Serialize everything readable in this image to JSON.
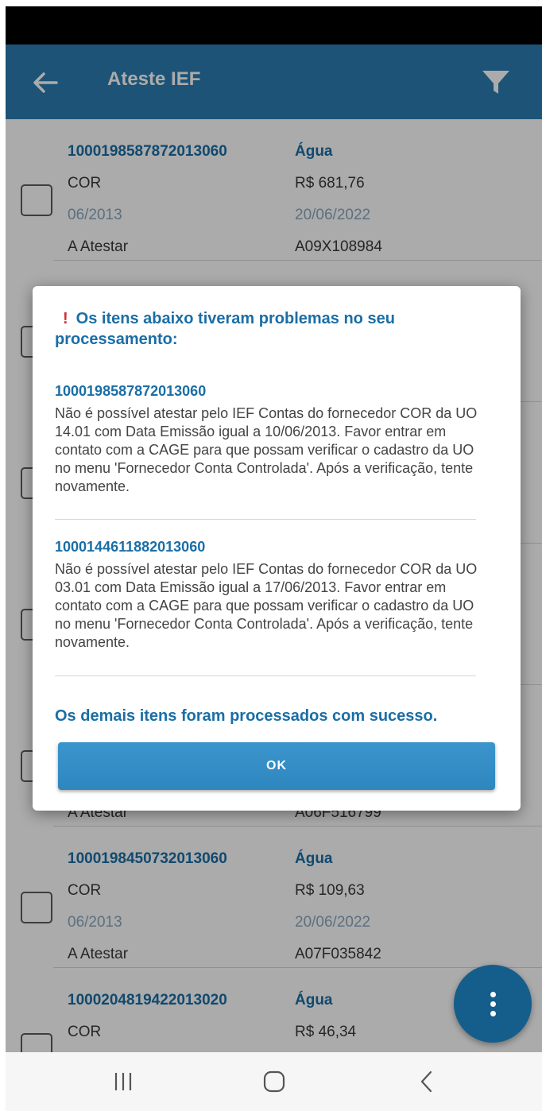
{
  "app_bar": {
    "title": "Ateste IEF",
    "back_icon": "back-arrow-icon",
    "filter_icon": "filter-icon",
    "color": "#2a7db0"
  },
  "list": {
    "items": [
      {
        "code": "1000198587872013060",
        "type": "Água",
        "supplier": "COR",
        "amount": "R$ 681,76",
        "reference": "06/2013",
        "date": "20/06/2022",
        "status": "A Atestar",
        "doc": "A09X108984"
      },
      {
        "code": "",
        "type": "",
        "supplier": "",
        "amount": "",
        "reference": "",
        "date": "",
        "status": "",
        "doc": ""
      },
      {
        "code": "",
        "type": "",
        "supplier": "",
        "amount": "",
        "reference": "",
        "date": "",
        "status": "",
        "doc": ""
      },
      {
        "code": "",
        "type": "",
        "supplier": "",
        "amount": "",
        "reference": "",
        "date": "",
        "status": "",
        "doc": ""
      },
      {
        "code": "",
        "type": "",
        "supplier": "",
        "amount": "",
        "reference": "",
        "date": "",
        "status": "A Atestar",
        "doc": "A06F516799"
      },
      {
        "code": "1000198450732013060",
        "type": "Água",
        "supplier": "COR",
        "amount": "R$ 109,63",
        "reference": "06/2013",
        "date": "20/06/2022",
        "status": "A Atestar",
        "doc": "A07F035842"
      },
      {
        "code": "1000204819422013020",
        "type": "Água",
        "supplier": "COR",
        "amount": "R$ 46,34",
        "reference": "",
        "date": "",
        "status": "",
        "doc": ""
      }
    ]
  },
  "dialog": {
    "warning_icon": "!",
    "header": "Os itens abaixo tiveram problemas no seu processamento:",
    "errors": [
      {
        "code": "1000198587872013060",
        "message": "Não é possível atestar pelo IEF Contas do fornecedor COR da UO 14.01 com Data Emissão igual a 10/06/2013. Favor entrar em contato com a CAGE para que possam verificar o cadastro da UO no menu 'Fornecedor Conta Controlada'. Após a verificação, tente novamente."
      },
      {
        "code": "1000144611882013060",
        "message": "Não é possível atestar pelo IEF Contas do fornecedor COR da UO 03.01 com Data Emissão igual a 17/06/2013. Favor entrar em contato com a CAGE para que possam verificar o cadastro da UO no menu 'Fornecedor Conta Controlada'. Após a verificação, tente novamente."
      }
    ],
    "footer": "Os demais itens foram processados com sucesso.",
    "ok_label": "OK"
  },
  "fab": {
    "icon": "more-vertical-icon",
    "color": "#155e8c"
  },
  "nav_bar": {
    "recents_icon": "recent-apps-icon",
    "home_icon": "home-icon",
    "back_icon": "back-chevron-icon"
  }
}
